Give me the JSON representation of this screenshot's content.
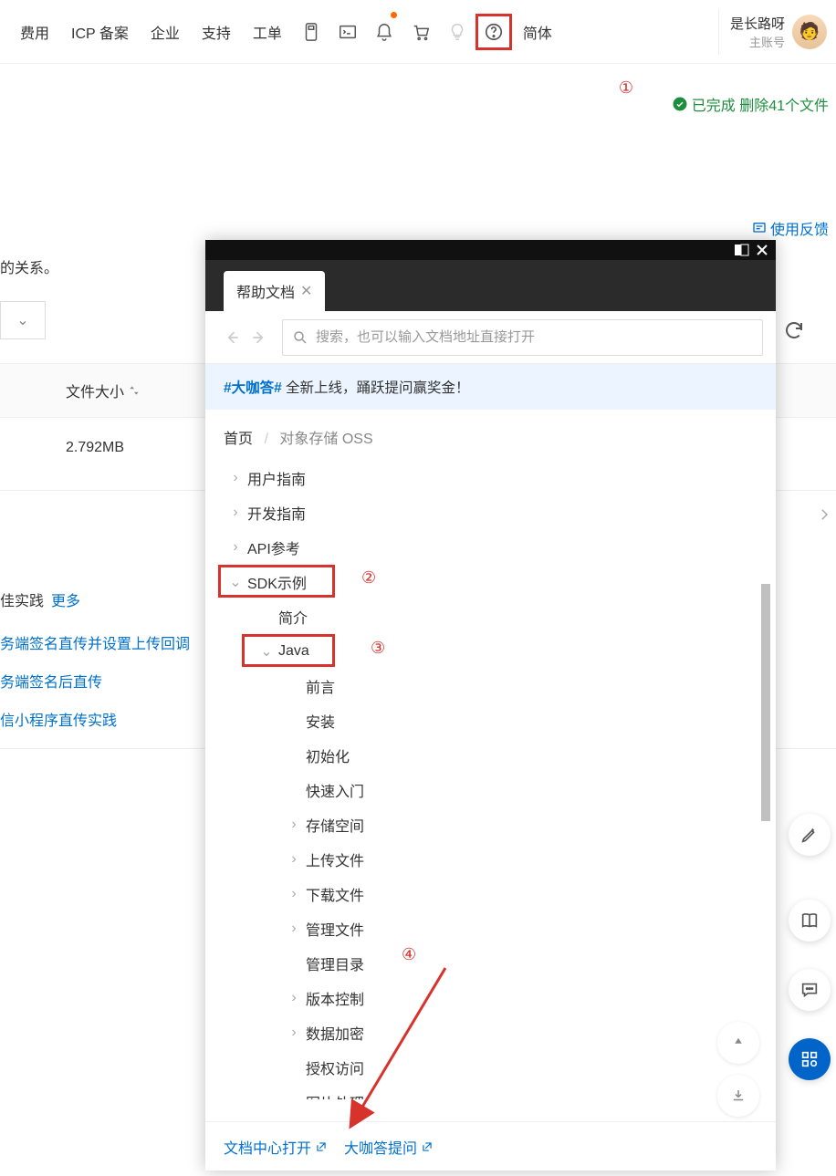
{
  "topnav": {
    "links": [
      "费用",
      "ICP 备案",
      "企业",
      "支持",
      "工单"
    ],
    "lang": "简体"
  },
  "user": {
    "name": "是长路呀",
    "role": "主账号"
  },
  "annotations": {
    "n1": "①",
    "n2": "②",
    "n3": "③",
    "n4": "④"
  },
  "status": {
    "text": "已完成 删除41个文件"
  },
  "feedback": "使用反馈",
  "bg": {
    "fragment": "的关系。",
    "col_size": "文件大小",
    "size_value": "2.792MB",
    "practice_label": "佳实践",
    "more": "更多",
    "links": [
      "务端签名直传并设置上传回调",
      "务端签名后直传",
      "信小程序直传实践"
    ]
  },
  "help": {
    "tab": "帮助文档",
    "search_placeholder": "搜索，也可以输入文档地址直接打开",
    "banner_hl": "#大咖答#",
    "banner_rest": " 全新上线，踊跃提问赢奖金！",
    "crumb_home": "首页",
    "crumb_current": "对象存储 OSS",
    "tree": {
      "l1": [
        "用户指南",
        "开发指南",
        "API参考",
        "SDK示例"
      ],
      "sdk_children": {
        "intro": "简介",
        "java": "Java",
        "java_children": [
          "前言",
          "安装",
          "初始化",
          "快速入门",
          "存储空间",
          "上传文件",
          "下载文件",
          "管理文件",
          "管理目录",
          "版本控制",
          "数据加密",
          "授权访问",
          "图片处理"
        ],
        "collapsible_idx": [
          4,
          5,
          6,
          7,
          9,
          10
        ]
      }
    },
    "footer": {
      "open_doc": "文档中心打开",
      "ask": "大咖答提问"
    }
  }
}
